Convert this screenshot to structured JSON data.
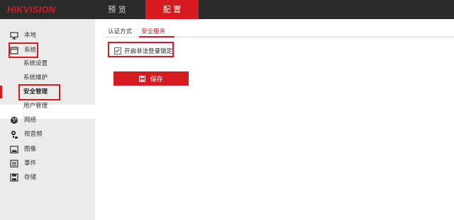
{
  "brand": "HIKVISION",
  "nav": {
    "preview": "预 览",
    "config": "配 置"
  },
  "sidebar": {
    "items": [
      {
        "label": "本地",
        "icon": "monitor-icon"
      },
      {
        "label": "系统",
        "icon": "system-icon"
      },
      {
        "label": "网络",
        "icon": "network-globe-icon"
      },
      {
        "label": "视音频",
        "icon": "audio-video-icon"
      },
      {
        "label": "图像",
        "icon": "image-icon"
      },
      {
        "label": "事件",
        "icon": "event-calendar-icon"
      },
      {
        "label": "存储",
        "icon": "storage-disk-icon"
      }
    ],
    "system_sub": [
      "系统设置",
      "系统维护",
      "安全管理",
      "用户管理"
    ]
  },
  "content": {
    "tabs": [
      "认证方式",
      "安全服务"
    ],
    "active_tab": "安全服务",
    "checkbox_label": "开启非法登录锁定",
    "checkbox_checked": true,
    "save_label": "保存"
  },
  "colors": {
    "accent": "#d71920",
    "topbar": "#2b2b2b",
    "sidebar": "#ebebeb"
  }
}
